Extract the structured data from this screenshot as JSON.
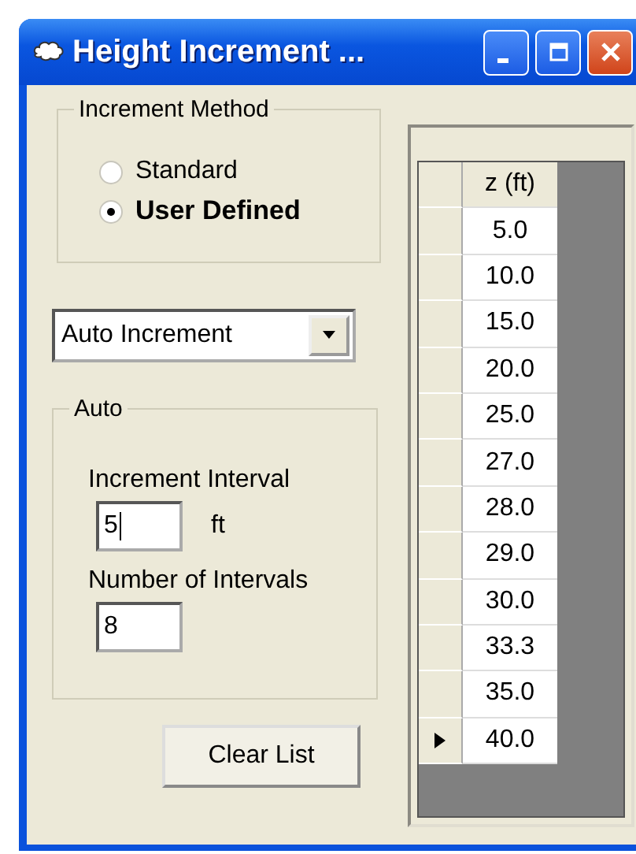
{
  "window": {
    "title": "Height Increment ..."
  },
  "increment_method": {
    "title": "Increment Method",
    "options": [
      {
        "label": "Standard",
        "selected": false
      },
      {
        "label": "User Defined",
        "selected": true
      }
    ]
  },
  "dropdown": {
    "value": "Auto Increment"
  },
  "auto": {
    "title": "Auto",
    "interval_label": "Increment Interval",
    "interval_value": "5",
    "interval_unit": "ft",
    "count_label": "Number of Intervals",
    "count_value": "8"
  },
  "clear_button": "Clear List",
  "table": {
    "columns": [
      "z (ft)"
    ],
    "rows": [
      {
        "value": "5.0",
        "current": false
      },
      {
        "value": "10.0",
        "current": false
      },
      {
        "value": "15.0",
        "current": false
      },
      {
        "value": "20.0",
        "current": false
      },
      {
        "value": "25.0",
        "current": false
      },
      {
        "value": "27.0",
        "current": false
      },
      {
        "value": "28.0",
        "current": false
      },
      {
        "value": "29.0",
        "current": false
      },
      {
        "value": "30.0",
        "current": false
      },
      {
        "value": "33.3",
        "current": false
      },
      {
        "value": "35.0",
        "current": false
      },
      {
        "value": "40.0",
        "current": true
      }
    ]
  }
}
